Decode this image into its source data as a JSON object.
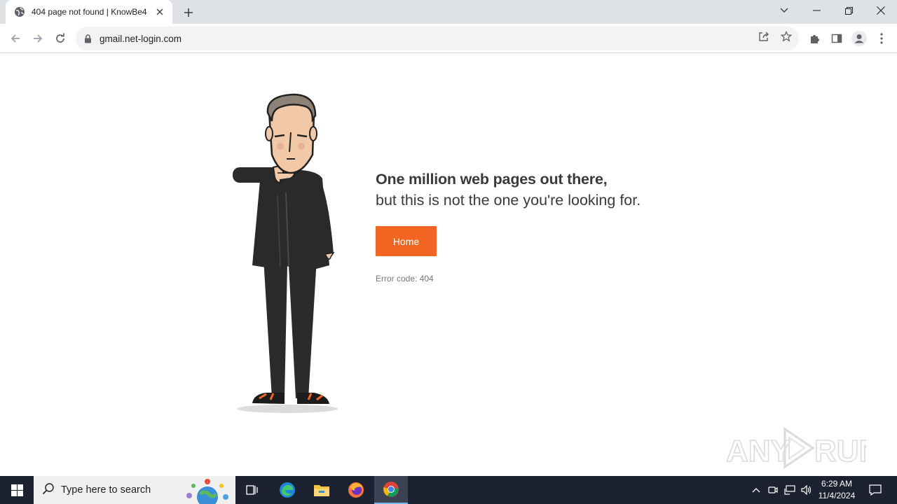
{
  "browser": {
    "tab_title": "404 page not found | KnowBe4",
    "url": "gmail.net-login.com"
  },
  "page": {
    "headline": "One million web pages out there,",
    "subline": "but this is not the one you're looking for.",
    "home_button": "Home",
    "error_code": "Error code: 404",
    "accent_color": "#f26522"
  },
  "watermark": {
    "text_left": "ANY",
    "text_right": "RUN"
  },
  "taskbar": {
    "search_placeholder": "Type here to search",
    "time": "6:29 AM",
    "date": "11/4/2024"
  }
}
